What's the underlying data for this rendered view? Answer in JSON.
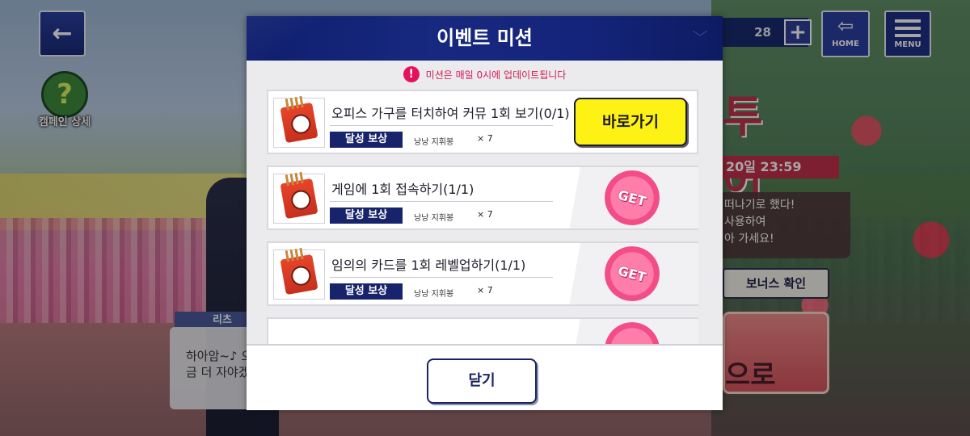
{
  "hud": {
    "back_icon": "←",
    "campaign_label": "캠페인 상세",
    "campaign_icon": "?",
    "counter_value": "28",
    "plus_icon": "+",
    "home_label": "HOME",
    "menu_label": "MENU"
  },
  "background_event": {
    "title_fragment": "투어",
    "date_fragment": "20일 23:59",
    "desc_lines": [
      "떠나기로 했다!",
      "사용하여",
      "아 가세요!"
    ],
    "bonus_button": "보너스 확인",
    "card_text": "으로"
  },
  "dialog": {
    "speaker": "리츠",
    "lines": [
      "하아암~♪ 오",
      "금 더 자야겠"
    ]
  },
  "modal": {
    "title": "이벤트 미션",
    "notice": "미션은 매일 0시에 업데이트됩니다",
    "missions": [
      {
        "title": "오피스 가구를 터치하여 커뮤 1회 보기(0/1)",
        "reward_label": "달성 보상",
        "reward_name": "낭낭 지휘봉",
        "reward_qty": "× 7",
        "status": "in_progress",
        "action_label": "바로가기"
      },
      {
        "title": "게임에 1회 접속하기(1/1)",
        "reward_label": "달성 보상",
        "reward_name": "낭낭 지휘봉",
        "reward_qty": "× 7",
        "status": "claimable",
        "action_label": "GET"
      },
      {
        "title": "임의의 카드를 1회 레벨업하기(1/1)",
        "reward_label": "달성 보상",
        "reward_name": "낭낭 지휘봉",
        "reward_qty": "× 7",
        "status": "claimable",
        "action_label": "GET"
      }
    ],
    "close_label": "닫기"
  },
  "colors": {
    "header_navy": "#14247a",
    "go_button_yellow": "#fdf214",
    "notice_red": "#d11b50",
    "get_pink": "#f24d86"
  }
}
